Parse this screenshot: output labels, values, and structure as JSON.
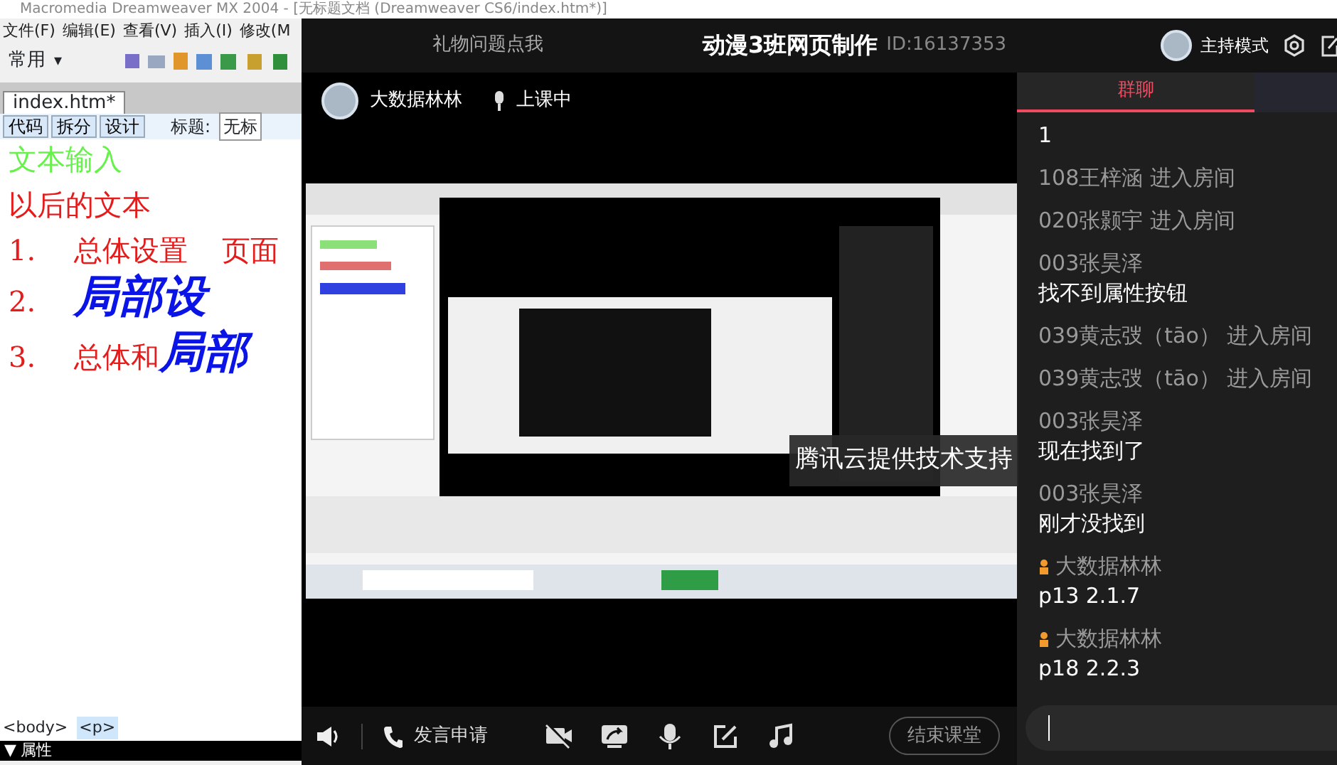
{
  "editor_window": {
    "title": "Macromedia Dreamweaver MX 2004 - [无标题文档 (Dreamweaver CS6/index.htm*)]",
    "menu": [
      "文件(F)",
      "编辑(E)",
      "查看(V)",
      "插入(I)",
      "修改(M"
    ],
    "insert_bar": "常用",
    "insert_bar_caret": "▾",
    "document_tab": "index.htm*",
    "view_buttons": [
      "代码",
      "拆分",
      "设计"
    ],
    "title_label": "标题:",
    "title_value": "无标",
    "document_lines": [
      {
        "kind": "plain",
        "text": "文本输入",
        "color": "#66f24a"
      },
      {
        "kind": "plain",
        "text": "以后的文本",
        "color": "#e51c1c"
      },
      {
        "kind": "numbered",
        "number": "1.",
        "segments": [
          {
            "kind": "plain",
            "text": "总体设置"
          },
          {
            "kind": "plain",
            "text": "页面"
          }
        ]
      },
      {
        "kind": "numbered",
        "number": "2.",
        "segments": [
          {
            "kind": "emphasis",
            "text": "局部设"
          }
        ]
      },
      {
        "kind": "numbered",
        "number": "3.",
        "segments": [
          {
            "kind": "plain",
            "text": "总体和"
          },
          {
            "kind": "emphasis",
            "text": "局部"
          }
        ]
      }
    ],
    "tag_selector": [
      {
        "label": "<body>",
        "selected": false
      },
      {
        "label": "<p>",
        "selected": true
      }
    ],
    "properties_panel": {
      "toggle": "▼",
      "label": "属性"
    }
  },
  "classroom_window": {
    "gift_link": "礼物问题点我",
    "title": "动漫3班网页制作",
    "room_id": "ID:16137353",
    "mode": "主持模式",
    "teacher": {
      "name": "大数据林林",
      "status": "上课中"
    },
    "watermark_caption": "腾讯云提供技术支持",
    "toolbar": {
      "speak_request": "发言申请",
      "end_button": "结束课堂"
    },
    "chat": {
      "tabs": [
        {
          "label": "群聊",
          "selected": true
        }
      ],
      "messages": [
        {
          "kind": "text",
          "body": "1"
        },
        {
          "kind": "system",
          "text": "108王梓涵 进入房间"
        },
        {
          "kind": "system",
          "text": "020张颢宇 进入房间"
        },
        {
          "kind": "message",
          "sender": "003张昊泽",
          "host": false,
          "body": "找不到属性按钮"
        },
        {
          "kind": "system",
          "text": "039黄志弢（tāo） 进入房间"
        },
        {
          "kind": "system",
          "text": "039黄志弢（tāo） 进入房间"
        },
        {
          "kind": "message",
          "sender": "003张昊泽",
          "host": false,
          "body": "现在找到了"
        },
        {
          "kind": "message",
          "sender": "003张昊泽",
          "host": false,
          "body": "刚才没找到"
        },
        {
          "kind": "message",
          "sender": "大数据林林",
          "host": true,
          "body": "p13 2.1.7"
        },
        {
          "kind": "message",
          "sender": "大数据林林",
          "host": true,
          "body": "p18 2.2.3"
        }
      ]
    }
  }
}
